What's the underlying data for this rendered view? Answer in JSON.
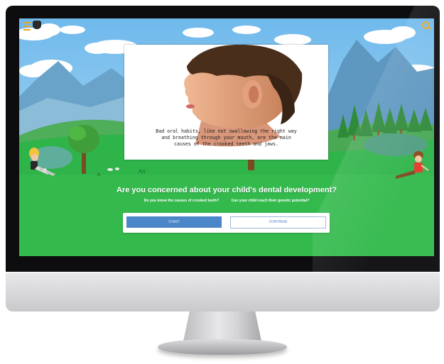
{
  "video": {
    "caption_lines": [
      "Bad oral habits, like not swallowing the right way",
      "and breathing through your mouth, are the main",
      "causes of the crooked teeth and jaws."
    ]
  },
  "main": {
    "headline": "Are you concerned about your child's dental development?",
    "question_1": "Do you know the causes of crooked teeth?",
    "question_2": "Can your child reach their genetic potential?"
  },
  "actions": {
    "start_label": "START",
    "continue_label": "CONTINUE"
  },
  "icons": {
    "menu": "hamburger-menu-icon",
    "logo": "hand-logo-icon",
    "search": "search-icon"
  },
  "colors": {
    "accent": "#f0a51b",
    "sky": "#7ec3ef",
    "grass": "#2fb44a",
    "button_primary": "#4a86c8"
  }
}
